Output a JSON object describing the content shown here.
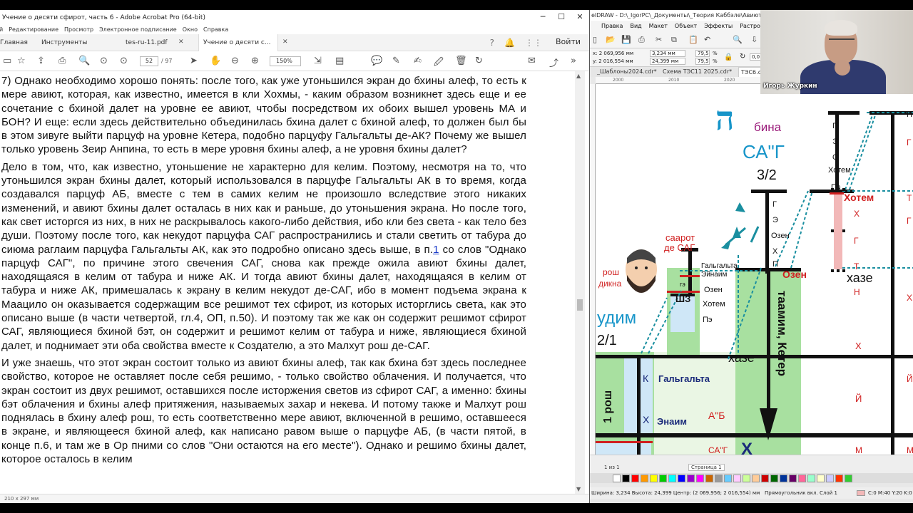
{
  "acrobat": {
    "window_title": "Учение о десяти сфирот, часть 6 - Adobe Acrobat Pro (64-bit)",
    "menu": [
      "Файл",
      "Редактирование",
      "Просмотр",
      "Электронное подписание",
      "Окно",
      "Справка"
    ],
    "menu_first_visible": "й",
    "tabs": {
      "home": "Главная",
      "tools": "Инструменты",
      "doc1": "tes-ru-11.pdf",
      "doc2": "Учение о десяти с..."
    },
    "login_label": "Войти",
    "page_current": "52",
    "page_total": "/ 97",
    "zoom": "150%",
    "paragraphs": [
      "7) Однако необходимо хорошо понять: после того, как уже утоньшился экран до бхины алеф, то есть к мере авиют, которая, как известно, имеется в кли Хохмы, - каким образом возникнет здесь еще и ее сочетание с бхиной далет на уровне ее авиют, чтобы посредством их обоих вышел уровень МА и БОН? И еще: если здесь действительно объединилась бхина далет с бхиной алеф, то должен был бы в этом зивуге выйти парцуф на уровне Кетера, подобно парцуфу Гальгальты де-АК? Почему же вышел только уровень Зеир Анпина, то есть в мере уровня бхины алеф, а не уровня бхины далет?",
      "Дело в том, что, как известно, утоньшение не характерно для келим. Поэтому, несмотря на то, что утоньшился экран бхины далет, который использовался в парцуфе Гальгальты АК в то время, когда создавался парцуф АБ, вместе с тем в самих келим не произошло вследствие этого никаких изменений, и авиют бхины далет осталась в них как и раньше, до утоньшения экрана. Но после того, как свет исторгся из них, в них не раскрывалось какого-либо действия, ибо кли без света - как тело без души. Поэтому после того, как некудот парцуфа САГ распространились и стали светить от табура до сиюма раглаим парцуфа Гальгальты АК, как это подробно описано здесь выше, в п.",
      "И уже знаешь, что этот экран состоит только из авиют бхины алеф, так как бхина бэт здесь последнее свойство, которое не оставляет после себя решимо, - только свойство облачения. И получается, что экран состоит из двух решимот, оставшихся после исторжения светов из сфирот САГ, а именно: бхины бэт облачения и бхины алеф притяжения, называемых захар и некева. И потому также и Малхут рош поднялась в бхину алеф рош, то есть соответственно мере авиют, включенной в решимо, оставшееся в экране, и являющееся бхиной алеф, как написано равом выше о парцуфе АБ, (в части пятой, в конце п.6, и там же в Ор пними со слов \"Они остаются на его месте\"). Однако и решимо бхины далет, которое осталось в келим"
    ],
    "p2_link": "1",
    "p2_rest": " со слов \"Однако парцуф САГ\", по причине этого свечения САГ, снова как прежде ожила авиют бхины далет, находящаяся в келим от табура и ниже АК. И тогда авиют бхины далет, находящаяся в келим от табура и ниже АК, примешалась к экрану в келим некудот де-САГ, ибо в момент подъема экрана к Маацило он оказывается содержащим все решимот тех сфирот, из которых исторглись света, как это описано выше (в части четвертой, гл.4, ОП, п.50). И поэтому так же как он содержит решимот сфирот САГ, являющиеся бхиной бэт, он содержит и решимот келим от табура и ниже, являющиеся бхиной далет, и поднимает эти оба свойства вместе к Создателю, а это Малхут рош де-САГ.",
    "status_size": "210 x 297 мм"
  },
  "corel": {
    "window_title": "elDRAW - D:\\_IgorPC\\_Документы\\_Теория Каббэле\\Авиют\\Рисун...",
    "menu": [
      "Правка",
      "Вид",
      "Макет",
      "Объект",
      "Эффекты",
      "Растро"
    ],
    "coord_x": "x: 2 069,956 мм",
    "coord_y": "y: 2 016,554 мм",
    "width_field": "3,234 мм",
    "height_field": "24,399 мм",
    "scale_x": "79,5",
    "scale_y": "79,5",
    "percent": "%",
    "rotation": "0,0",
    "doc_tabs": [
      "_Шаблоны2024.cdr*",
      "Схема ТЭС11 2025.cdr*",
      "ТЭС6.cd"
    ],
    "ruler_ticks": [
      "2000",
      "2010",
      "2020",
      "2030",
      "2040"
    ],
    "page_label": "Страница 1",
    "page_nav": "1 из 1",
    "status_text": "Ширина: 3,234 Высота: 24,399 Центр: (2 069,956; 2 016,554) мм",
    "status_layer": "Прямоугольник вкл. Слой 1",
    "status_cmyk": "C:0 M:40 Y:20 K:0",
    "diagram": {
      "hey_letter": "ה",
      "bina": "бина",
      "sag": "СА\"Г",
      "fraction": "3/2",
      "saarot": [
        "саарот",
        "де САГ"
      ],
      "rosh_dikna": [
        "рош",
        "дикна"
      ],
      "galgalta_enaim_small": [
        "Гальгальта",
        "Эйнаим"
      ],
      "ozen_hotem_pe": [
        "Озен",
        "Хотем",
        "Пэ"
      ],
      "shz": "ШЗ",
      "ge": "гэ",
      "nudim": "удим",
      "fraction2": "2/1",
      "rosh1": "1 рош",
      "hotem_red": "Хотем",
      "ozen_red": "Озен",
      "haze1": "хазе",
      "haze2": "хазе",
      "taamim": "таамим, Кетер",
      "galgalta": "Гальгальта",
      "enaim": "Энаим",
      "ab": "А\"Б",
      "sag_bottom": "СА\"Г",
      "col1_letters": [
        "Г",
        "Э",
        "О",
        "Хотем",
        "Пэ"
      ],
      "col2_letters": [
        "Г",
        "Э",
        "Озен",
        "Х",
        "П"
      ],
      "col3_letters": [
        "Х",
        "Г",
        "Т",
        "Н"
      ],
      "col4_letters": [
        "П",
        "Г",
        "Т",
        "Г",
        "Х",
        "Х",
        "Й",
        "Й",
        "М",
        "М"
      ],
      "k_letter": "К",
      "kh_letter": "Х",
      "big_kh": "Х"
    },
    "palette_colors": [
      "#ffffff",
      "#000000",
      "#ff0000",
      "#ff9900",
      "#ffff00",
      "#00cc00",
      "#00ffff",
      "#0000ff",
      "#9900cc",
      "#ff00ff",
      "#cc6600",
      "#999999",
      "#66ccff",
      "#ffccff",
      "#ccff99",
      "#ffcc99",
      "#cc0000",
      "#006600",
      "#003399",
      "#660066",
      "#ff6699",
      "#99ffcc",
      "#ffffcc",
      "#ccccff",
      "#ff3300",
      "#33cc33"
    ]
  },
  "webcam": {
    "name": "Игорь Журкин"
  }
}
